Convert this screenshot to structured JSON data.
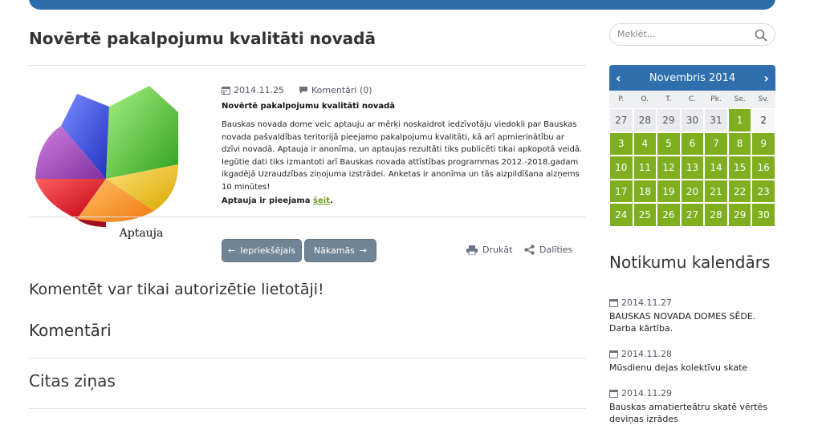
{
  "article": {
    "title": "Novērtē pakalpojumu kvalitāti novadā",
    "thumb_caption": "Aptauja",
    "date": "2014.11.25",
    "comments": "Komentāri (0)",
    "subtitle": "Novērtē pakalpojumu kvalitāti novadā",
    "body": "Bauskas novada dome veic aptauju ar mērķi noskaidrot iedzīvotāju viedokli par Bauskas novada pašvaldības teritorijā pieejamo pakalpojumu kvalitāti, kā arī apmierinātību ar dzīvi novadā. Aptauja ir anonīma, un aptaujas rezultāti tiks publicēti tikai apkopotā veidā. Iegūtie dati tiks izmantoti arī Bauskas novada attīstības programmas 2012.-2018.gadam ikgadējā Uzraudzības ziņojuma izstrādei. Anketas ir anonīma un tās aizpildīšana aizņems 10 minūtes!",
    "available_text": "Aptauja ir pieejama ",
    "available_link": "šeit",
    "available_end": "."
  },
  "actions": {
    "prev": "Iepriekšējais",
    "next": "Nākamās",
    "print": "Drukāt",
    "share": "Dalīties"
  },
  "sections": {
    "comment_notice": "Komentēt var tikai autorizētie lietotāji!",
    "comments": "Komentāri",
    "other_news": "Citas ziņas"
  },
  "sidebar": {
    "search_placeholder": "Meklēt...",
    "calendar": {
      "title": "Novembris 2014",
      "weekdays": [
        "P.",
        "O.",
        "T.",
        "C.",
        "Pk.",
        "Se.",
        "Sv."
      ],
      "days": [
        {
          "d": "27",
          "t": "other"
        },
        {
          "d": "28",
          "t": "other"
        },
        {
          "d": "29",
          "t": "other"
        },
        {
          "d": "30",
          "t": "other"
        },
        {
          "d": "31",
          "t": "other"
        },
        {
          "d": "1",
          "t": "ev"
        },
        {
          "d": "2",
          "t": "plain"
        },
        {
          "d": "3",
          "t": "ev"
        },
        {
          "d": "4",
          "t": "ev"
        },
        {
          "d": "5",
          "t": "ev"
        },
        {
          "d": "6",
          "t": "ev"
        },
        {
          "d": "7",
          "t": "ev"
        },
        {
          "d": "8",
          "t": "ev"
        },
        {
          "d": "9",
          "t": "ev"
        },
        {
          "d": "10",
          "t": "ev"
        },
        {
          "d": "11",
          "t": "ev"
        },
        {
          "d": "12",
          "t": "ev"
        },
        {
          "d": "13",
          "t": "ev"
        },
        {
          "d": "14",
          "t": "ev"
        },
        {
          "d": "15",
          "t": "ev"
        },
        {
          "d": "16",
          "t": "ev"
        },
        {
          "d": "17",
          "t": "ev"
        },
        {
          "d": "18",
          "t": "ev"
        },
        {
          "d": "19",
          "t": "ev"
        },
        {
          "d": "20",
          "t": "ev"
        },
        {
          "d": "21",
          "t": "ev"
        },
        {
          "d": "22",
          "t": "ev"
        },
        {
          "d": "23",
          "t": "ev"
        },
        {
          "d": "24",
          "t": "ev"
        },
        {
          "d": "25",
          "t": "ev"
        },
        {
          "d": "26",
          "t": "ev"
        },
        {
          "d": "27",
          "t": "ev"
        },
        {
          "d": "28",
          "t": "ev"
        },
        {
          "d": "29",
          "t": "ev"
        },
        {
          "d": "30",
          "t": "ev"
        }
      ]
    },
    "events_title": "Notikumu kalendārs",
    "events": [
      {
        "date": "2014.11.27",
        "text": "BAUSKAS NOVADA DOMES SĒDE. Darba kārtība."
      },
      {
        "date": "2014.11.28",
        "text": "Mūsdienu dejas kolektīvu skate"
      },
      {
        "date": "2014.11.29",
        "text": "Bauskas amatierteātru skatē vērtēs deviņas izrādes"
      }
    ]
  },
  "colors": {
    "accent": "#2f6fae",
    "event_day": "#7fae1e",
    "button": "#6f8495",
    "link": "#6a9a1a"
  }
}
